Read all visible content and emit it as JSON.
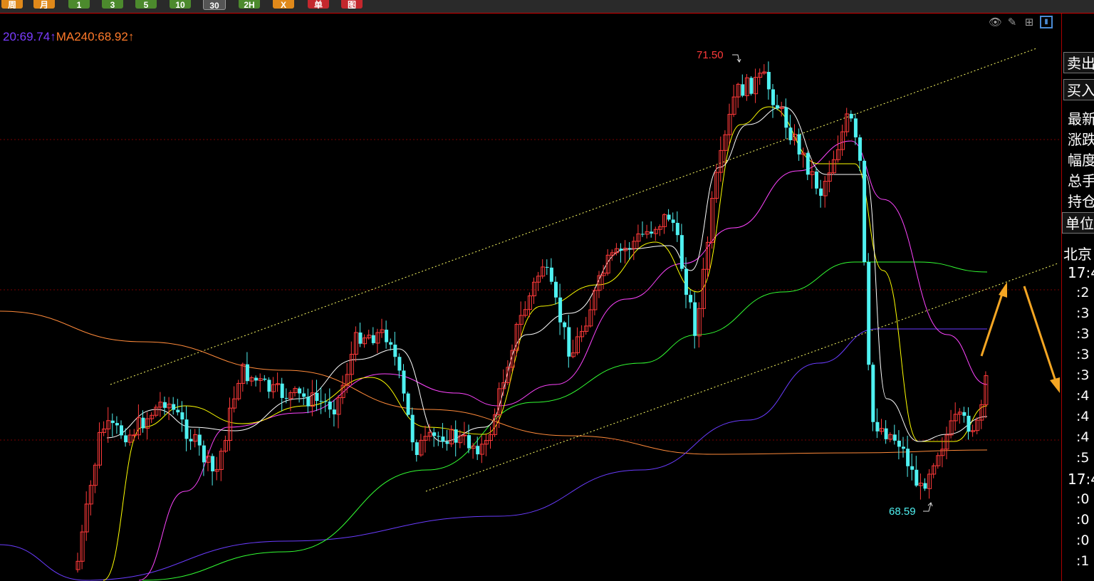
{
  "toolbar": {
    "buttons": [
      {
        "label": "周",
        "color": "orange"
      },
      {
        "label": "月",
        "color": "orange"
      },
      {
        "label": "1",
        "color": "green"
      },
      {
        "label": "3",
        "color": "green"
      },
      {
        "label": "5",
        "color": "green"
      },
      {
        "label": "10",
        "color": "green"
      },
      {
        "label": "30",
        "color": "gray"
      },
      {
        "label": "2H",
        "color": "green"
      },
      {
        "label": "X",
        "color": "orange"
      },
      {
        "label": "单",
        "color": "red"
      },
      {
        "label": "图",
        "color": "red"
      }
    ]
  },
  "indicator": {
    "ma_purple": "20:69.74↑",
    "ma240": "MA240:68.92↑"
  },
  "annotations": {
    "high": "71.50",
    "low": "68.59"
  },
  "top_icons": [
    "eye-icon",
    "pencil-icon",
    "grid-icon",
    "panel-icon"
  ],
  "sidebar": {
    "sell": "卖出",
    "buy": "买入",
    "latest": "最新",
    "change": "涨跌",
    "amplitude": "幅度",
    "total_volume": "总手",
    "open_interest": "持仓",
    "unit": "单位",
    "beijing": "北京",
    "time1": "17:4",
    "ticks1": [
      ":2",
      ":3",
      ":3",
      ":3",
      ":3",
      ":4",
      ":4",
      ":4",
      ":5"
    ],
    "time2": "17:4",
    "ticks2": [
      ":0",
      ":0",
      ":0",
      ":1"
    ]
  },
  "colors": {
    "up": "#ff3a3a",
    "down": "#4ff1f1",
    "ma5": "#ffffff",
    "ma10": "#ffff00",
    "ma20": "#ff44ff",
    "ma60": "#33ff33",
    "ma120": "#6a3cff",
    "ma240": "#ff8a3a",
    "arrow": "#f5a623"
  }
}
